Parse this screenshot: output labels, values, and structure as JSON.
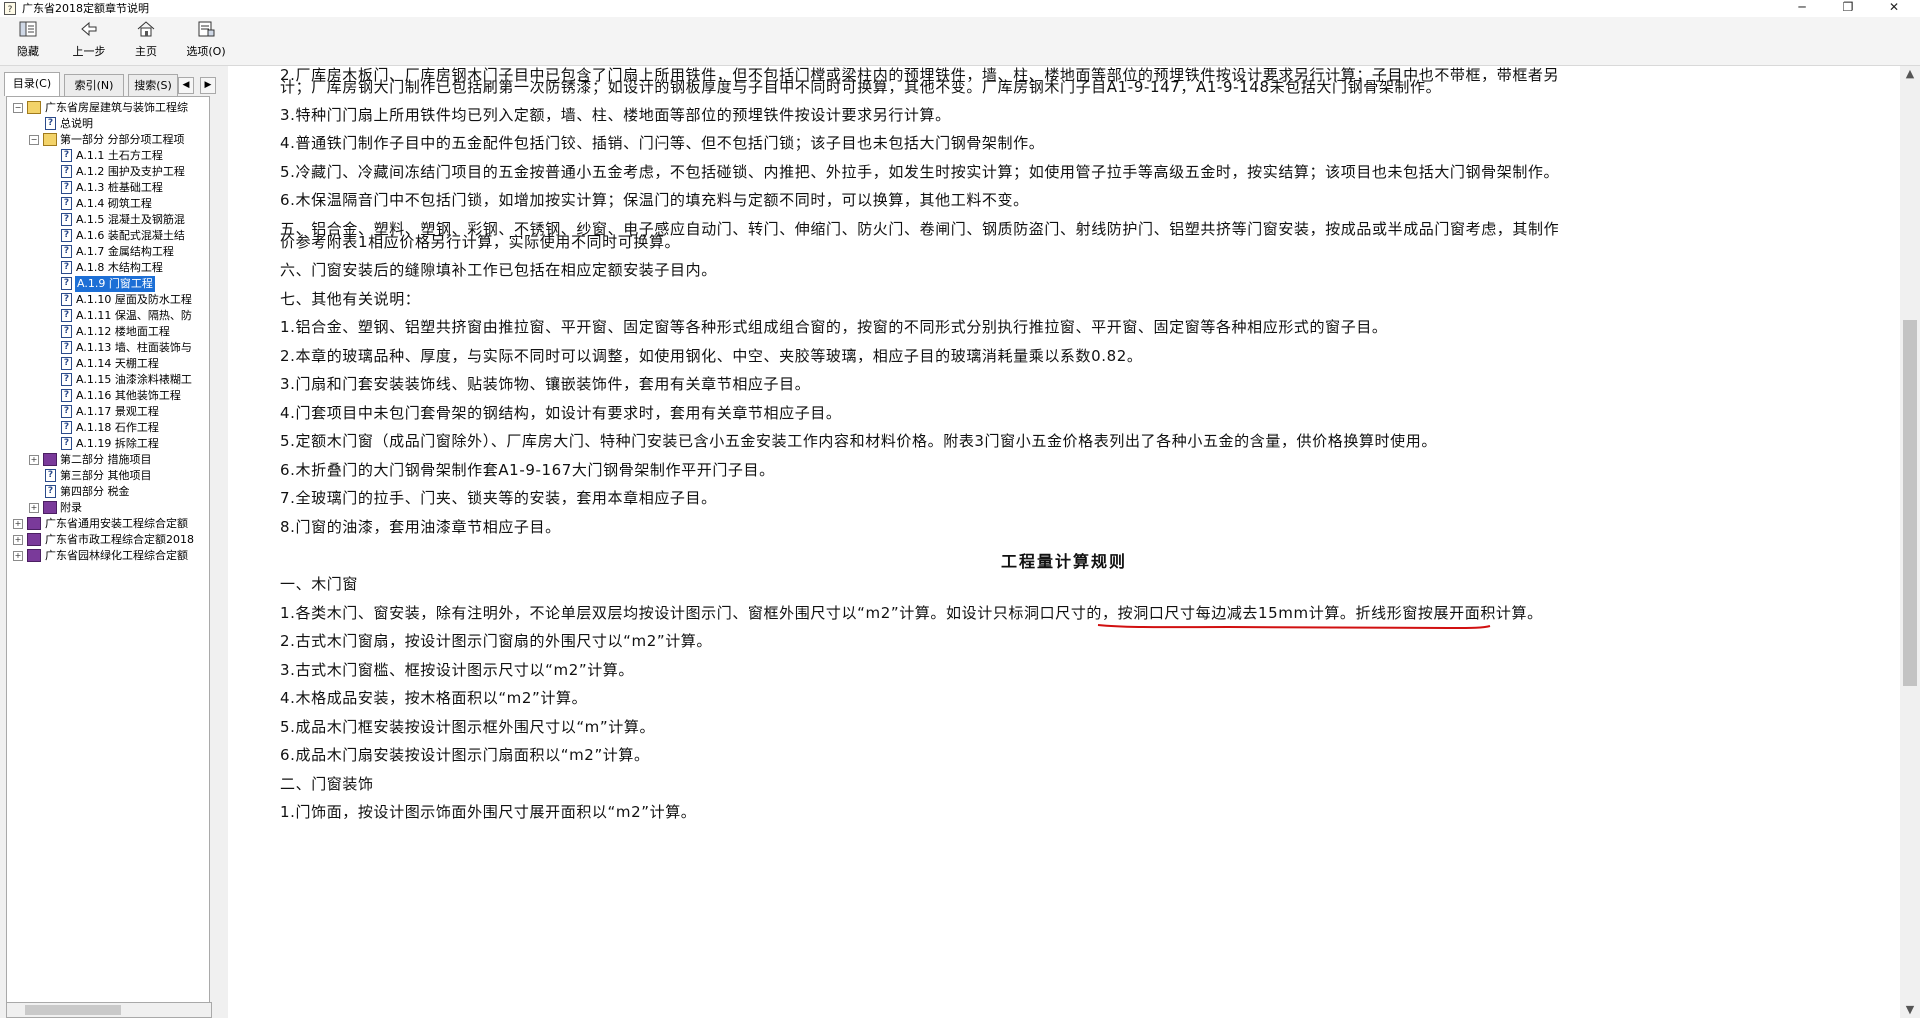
{
  "window": {
    "title": "广东省2018定额章节说明",
    "controls": {
      "minimize": "─",
      "restore": "❐",
      "close": "✕"
    }
  },
  "toolbar": {
    "hide": "隐藏",
    "back": "上一步",
    "home": "主页",
    "options": "选项(O)"
  },
  "tabs": {
    "contents": "目录(C)",
    "index": "索引(N)",
    "search": "搜索(S)",
    "prev_arrow": "◀",
    "next_arrow": "▶"
  },
  "tree": {
    "root": "广东省房屋建筑与装饰工程综",
    "general": "总说明",
    "part1": "第一部分 分部分项工程项",
    "items": [
      "A.1.1 土石方工程",
      "A.1.2 围护及支护工程",
      "A.1.3 桩基础工程",
      "A.1.4 砌筑工程",
      "A.1.5 混凝土及钢筋混",
      "A.1.6 装配式混凝土结",
      "A.1.7 金属结构工程",
      "A.1.8 木结构工程",
      "A.1.9 门窗工程",
      "A.1.10 屋面及防水工程",
      "A.1.11 保温、隔热、防",
      "A.1.12 楼地面工程",
      "A.1.13 墙、柱面装饰与",
      "A.1.14 天棚工程",
      "A.1.15 油漆涂料裱糊工",
      "A.1.16 其他装饰工程",
      "A.1.17 景观工程",
      "A.1.18 石作工程",
      "A.1.19 拆除工程"
    ],
    "part2": "第二部分 措施项目",
    "part3": "第三部分 其他项目",
    "part4": "第四部分 税金",
    "appendix": "附录",
    "book2": "广东省通用安装工程综合定额",
    "book3": "广东省市政工程综合定额2018",
    "book4": "广东省园林绿化工程综合定额"
  },
  "content": {
    "p1_line1": "2.厂库房木板门、厂库房钢木门子目中已包含了门扇上所用铁件，但不包括门樘或梁柱内的预埋铁件，墙、柱、楼地面等部位的预埋铁件按设计要求另行计算；子目中也不带框，带框者另",
    "p1_line2": "计；厂库房钢大门制作已包括刷第一次防锈漆；如设计的钢板厚度与子目中不同时可换算，其他不变。厂库房钢木门子目A1-9-147，A1-9-148未包括大门钢骨架制作。",
    "p2": "3.特种门门扇上所用铁件均已列入定额，墙、柱、楼地面等部位的预埋铁件按设计要求另行计算。",
    "p3": "4.普通铁门制作子目中的五金配件包括门铰、插销、门闩等、但不包括门锁；该子目也未包括大门钢骨架制作。",
    "p4": "5.冷藏门、冷藏间冻结门项目的五金按普通小五金考虑，不包括碰锁、内推把、外拉手，如发生时按实计算；如使用管子拉手等高级五金时，按实结算；该项目也未包括大门钢骨架制作。",
    "p5": "6.木保温隔音门中不包括门锁，如增加按实计算；保温门的填充料与定额不同时，可以换算，其他工料不变。",
    "p6_line1": "五、铝合金、塑料、塑钢、彩钢、不锈钢、纱窗、电子感应自动门、转门、伸缩门、防火门、卷闸门、钢质防盗门、射线防护门、铝塑共挤等门窗安装，按成品或半成品门窗考虑，其制作",
    "p6_line2": "价参考附表1相应价格另行计算，实际使用不同时可换算。",
    "p7": "六、门窗安装后的缝隙填补工作已包括在相应定额安装子目内。",
    "p8": "七、其他有关说明：",
    "p9": "1.铝合金、塑钢、铝塑共挤窗由推拉窗、平开窗、固定窗等各种形式组成组合窗的，按窗的不同形式分别执行推拉窗、平开窗、固定窗等各种相应形式的窗子目。",
    "p10": "2.本章的玻璃品种、厚度，与实际不同时可以调整，如使用钢化、中空、夹胶等玻璃，相应子目的玻璃消耗量乘以系数0.82。",
    "p11": "3.门扇和门套安装装饰线、贴装饰物、镶嵌装饰件，套用有关章节相应子目。",
    "p12": "4.门套项目中未包门套骨架的钢结构，如设计有要求时，套用有关章节相应子目。",
    "p13": "5.定额木门窗（成品门窗除外）、厂库房大门、特种门安装已含小五金安装工作内容和材料价格。附表3门窗小五金价格表列出了各种小五金的含量，供价格换算时使用。",
    "p14": "6.木折叠门的大门钢骨架制作套A1-9-167大门钢骨架制作平开门子目。",
    "p15": "7.全玻璃门的拉手、门夹、锁夹等的安装，套用本章相应子目。",
    "p16": "8.门窗的油漆，套用油漆章节相应子目。",
    "heading": "工程量计算规则",
    "s1": "一、木门窗",
    "r1": "1.各类木门、窗安装，除有注明外，不论单层双层均按设计图示门、窗框外围尺寸以“m2”计算。如设计只标洞口尺寸的，按洞口尺寸每边减去15mm计算。折线形窗按展开面积计算。",
    "r2": "2.古式木门窗扇，按设计图示门窗扇的外围尺寸以“m2”计算。",
    "r3": "3.古式木门窗槛、框按设计图示尺寸以“m2”计算。",
    "r4": "4.木格成品安装，按木格面积以“m2”计算。",
    "r5": "5.成品木门框安装按设计图示框外围尺寸以“m”计算。",
    "r6": "6.成品木门扇安装按设计图示门扇面积以“m2”计算。",
    "s2": "二、门窗装饰",
    "r7": "1.门饰面，按设计图示饰面外围尺寸展开面积以“m2”计算。"
  },
  "colors": {
    "selection": "#1c6fd6",
    "annotation": "#d11010"
  }
}
